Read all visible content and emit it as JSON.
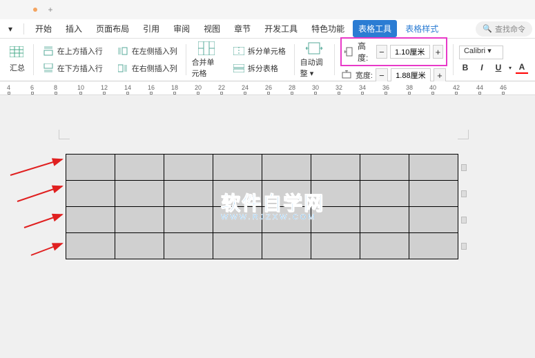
{
  "menu": {
    "items": [
      "开始",
      "插入",
      "页面布局",
      "引用",
      "审阅",
      "视图",
      "章节",
      "开发工具",
      "特色功能"
    ],
    "active": "表格工具",
    "light": "表格样式"
  },
  "search": {
    "placeholder": "查找命令"
  },
  "toolbar": {
    "summary": "汇总",
    "insert_above": "在上方插入行",
    "insert_below": "在下方插入行",
    "insert_left": "在左侧插入列",
    "insert_right": "在右侧插入列",
    "merge": "合并单元格",
    "split_cell": "拆分单元格",
    "split_table": "拆分表格",
    "auto_fit": "自动调整",
    "height_label": "高度:",
    "height_value": "1.10厘米",
    "width_label": "宽度:",
    "width_value": "1.88厘米",
    "font": "Calibri",
    "bold": "B",
    "italic": "I",
    "underline": "U",
    "strike": "A"
  },
  "ruler": {
    "marks": [
      4,
      6,
      8,
      10,
      12,
      14,
      16,
      18,
      20,
      22,
      24,
      26,
      28,
      30,
      32,
      34,
      36,
      38,
      40,
      42,
      44,
      46
    ]
  },
  "watermark": {
    "title": "软件自学网",
    "sub": "WWW.RJZXW.COM"
  }
}
